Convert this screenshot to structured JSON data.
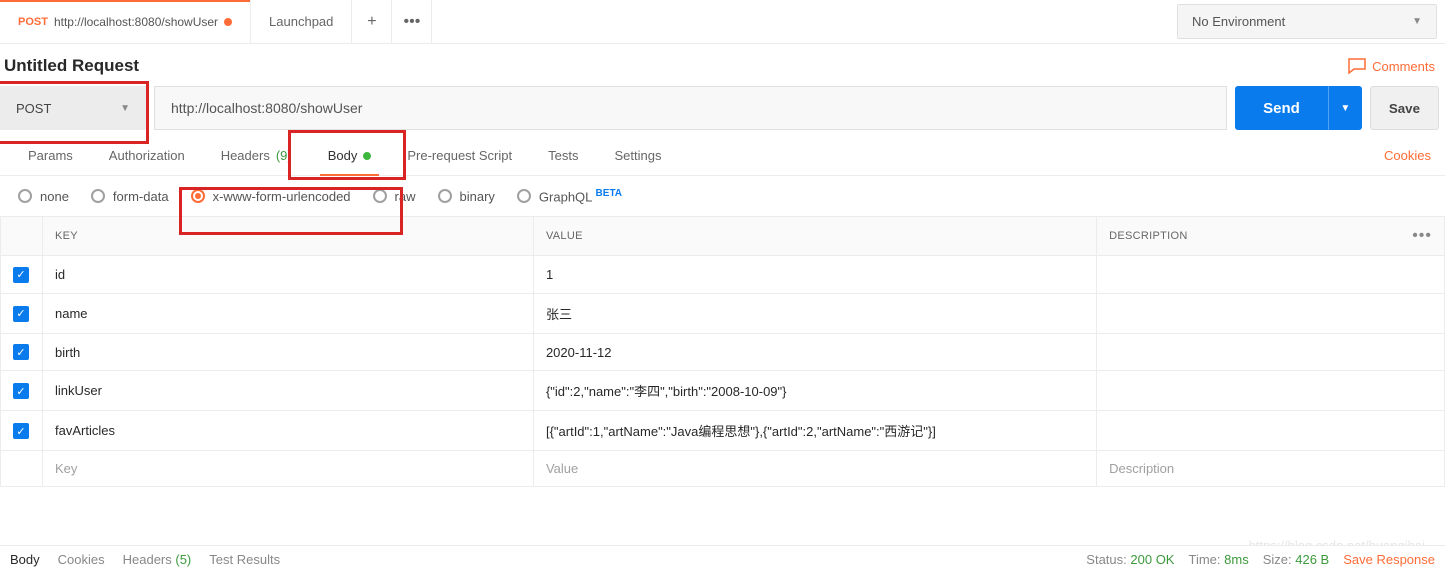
{
  "tabs": [
    {
      "method": "POST",
      "url": "http://localhost:8080/showUser",
      "active": true,
      "unsaved": true
    },
    {
      "label": "Launchpad"
    }
  ],
  "env": {
    "label": "No Environment"
  },
  "request": {
    "title": "Untitled Request",
    "comments_label": "Comments",
    "method": "POST",
    "url": "http://localhost:8080/showUser",
    "send_label": "Send",
    "save_label": "Save"
  },
  "req_tabs": {
    "params": "Params",
    "auth": "Authorization",
    "headers": "Headers",
    "headers_count": "(9)",
    "body": "Body",
    "prerequest": "Pre-request Script",
    "tests": "Tests",
    "settings": "Settings",
    "cookies": "Cookies"
  },
  "body_types": {
    "none": "none",
    "form": "form-data",
    "urlenc": "x-www-form-urlencoded",
    "raw": "raw",
    "binary": "binary",
    "graphql": "GraphQL",
    "beta": "BETA"
  },
  "kv": {
    "headers": {
      "key": "KEY",
      "value": "VALUE",
      "desc": "DESCRIPTION"
    },
    "rows": [
      {
        "k": "id",
        "v": "1"
      },
      {
        "k": "name",
        "v": "张三"
      },
      {
        "k": "birth",
        "v": "2020-11-12"
      },
      {
        "k": "linkUser",
        "v": "{\"id\":2,\"name\":\"李四\",\"birth\":\"2008-10-09\"}"
      },
      {
        "k": "favArticles",
        "v": "[{\"artId\":1,\"artName\":\"Java编程思想\"},{\"artId\":2,\"artName\":\"西游记\"}]"
      }
    ],
    "ph": {
      "key": "Key",
      "value": "Value",
      "desc": "Description"
    }
  },
  "footer": {
    "body": "Body",
    "cookies": "Cookies",
    "headers": "Headers",
    "headers_count": "(5)",
    "testresults": "Test Results",
    "status_label": "Status:",
    "status_value": "200 OK",
    "time_label": "Time:",
    "time_value": "8ms",
    "size_label": "Size:",
    "size_value": "426 B",
    "save_response": "Save Response"
  },
  "watermark": "https://blog.csdn.net/huangjhai"
}
